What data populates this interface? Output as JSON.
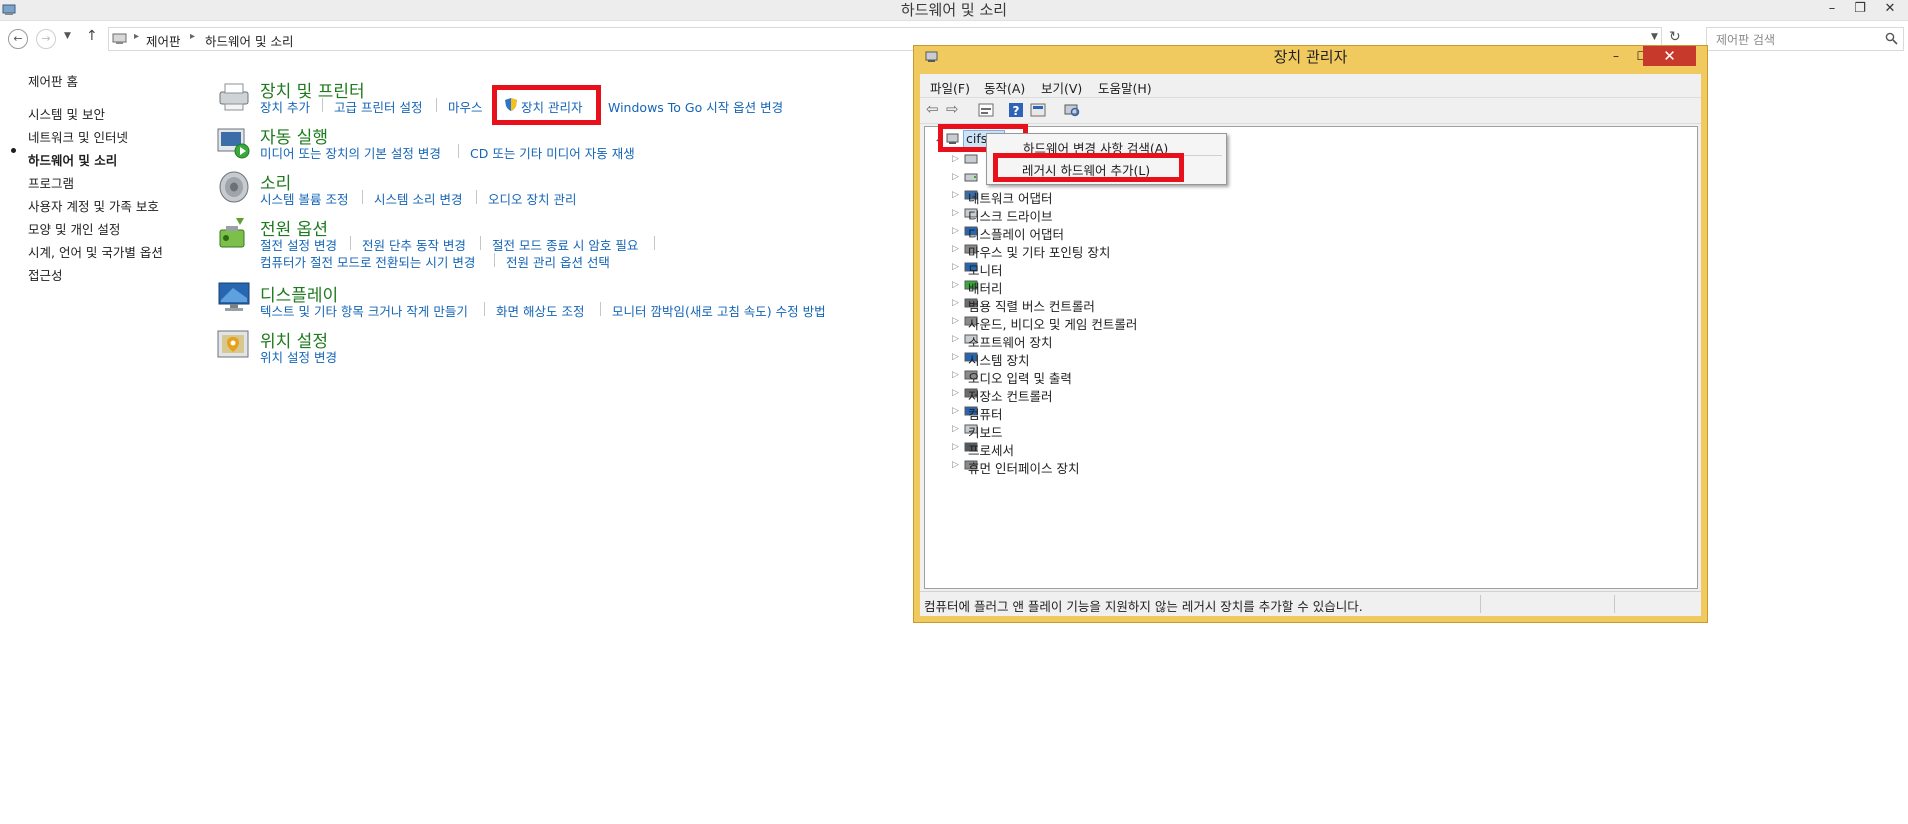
{
  "window": {
    "title": "하드웨어 및 소리"
  },
  "breadcrumb": [
    "제어판",
    "하드웨어 및 소리"
  ],
  "search": {
    "placeholder": "제어판 검색"
  },
  "leftnav": {
    "items": [
      "제어판 홈",
      "시스템 및 보안",
      "네트워크 및 인터넷",
      "하드웨어 및 소리",
      "프로그램",
      "사용자 계정 및 가족 보호",
      "모양 및 개인 설정",
      "시계, 언어 및 국가별 옵션",
      "접근성"
    ],
    "active": "하드웨어 및 소리"
  },
  "categories": [
    {
      "title": "장치 및 프린터",
      "links": [
        [
          "장치 추가",
          "고급 프린터 설정",
          "마우스",
          "장치 관리자",
          "Windows To Go 시작 옵션 변경"
        ]
      ]
    },
    {
      "title": "자동 실행",
      "links": [
        [
          "미디어 또는 장치의 기본 설정 변경",
          "CD 또는 기타 미디어 자동 재생"
        ]
      ]
    },
    {
      "title": "소리",
      "links": [
        [
          "시스템 볼륨 조정",
          "시스템 소리 변경",
          "오디오 장치 관리"
        ]
      ]
    },
    {
      "title": "전원 옵션",
      "links": [
        [
          "절전 설정 변경",
          "전원 단추 동작 변경",
          "절전 모드 종료 시 암호 필요"
        ],
        [
          "컴퓨터가 절전 모드로 전환되는 시기 변경",
          "전원 관리 옵션 선택"
        ]
      ]
    },
    {
      "title": "디스플레이",
      "links": [
        [
          "텍스트 및 기타 항목 크거나 작게 만들기",
          "화면 해상도 조정",
          "모니터 깜박임(새로 고침 속도) 수정 방법"
        ]
      ]
    },
    {
      "title": "위치 설정",
      "links": [
        [
          "위치 설정 변경"
        ]
      ]
    }
  ],
  "device_manager": {
    "title": "장치 관리자",
    "menu": [
      "파일(F)",
      "동작(A)",
      "보기(V)",
      "도움말(H)"
    ],
    "root_node": "cifsr",
    "tree": [
      "네트워크 어댑터",
      "디스크 드라이브",
      "디스플레이 어댑터",
      "마우스 및 기타 포인팅 장치",
      "모니터",
      "배터리",
      "범용 직렬 버스 컨트롤러",
      "사운드, 비디오 및 게임 컨트롤러",
      "소프트웨어 장치",
      "시스템 장치",
      "오디오 입력 및 출력",
      "저장소 컨트롤러",
      "컴퓨터",
      "키보드",
      "프로세서",
      "휴먼 인터페이스 장치"
    ],
    "context_menu": [
      "하드웨어 변경 사항 검색(A)",
      "레거시 하드웨어 추가(L)"
    ],
    "status": "컴퓨터에 플러그 앤 플레이 기능을 지원하지 않는 레거시 장치를 추가할 수 있습니다."
  },
  "colors": {
    "accent_link": "#1565b7",
    "category_title": "#1e7a1e",
    "highlight": "#e8101a",
    "dm_frame": "#f0c95f"
  }
}
